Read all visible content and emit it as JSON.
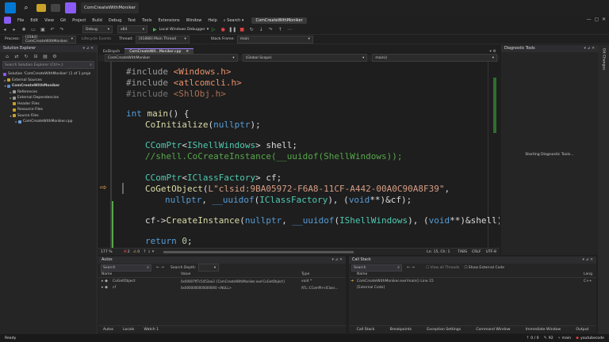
{
  "taskbar": {
    "search_icon": "search-icon",
    "app_label": "ComCreateWithMoniker"
  },
  "menu": {
    "items": [
      "File",
      "Edit",
      "View",
      "Git",
      "Project",
      "Build",
      "Debug",
      "Test",
      "Tools",
      "Extensions",
      "Window",
      "Help"
    ],
    "search": "Search",
    "solution_title": "ComCreateWithMoniker"
  },
  "toolbar": {
    "config": "Debug",
    "platform": "x64",
    "run_label": "Local Windows Debugger"
  },
  "debugbar": {
    "process_label": "Process:",
    "process_value": "[3584] ComCreateWithMoniker.",
    "lifecycle": "Lifecycle Events",
    "thread_label": "Thread:",
    "thread_value": "[41888] Main Thread",
    "stack_label": "Stack Frame:",
    "stack_value": "main"
  },
  "solution_explorer": {
    "title": "Solution Explorer",
    "search_placeholder": "Search Solution Explorer (Ctrl+;)",
    "items": [
      {
        "label": "Solution 'ComCreateWithMoniker' (1 of 1 proje",
        "indent": 1,
        "bold": false
      },
      {
        "label": "External Sources",
        "indent": 1,
        "bold": false
      },
      {
        "label": "ComCreateWithMoniker",
        "indent": 1,
        "bold": true
      },
      {
        "label": "References",
        "indent": 2,
        "bold": false
      },
      {
        "label": "External Dependencies",
        "indent": 2,
        "bold": false
      },
      {
        "label": "Header Files",
        "indent": 2,
        "bold": false
      },
      {
        "label": "Resource Files",
        "indent": 2,
        "bold": false
      },
      {
        "label": "Source Files",
        "indent": 2,
        "bold": false
      },
      {
        "label": "ComCreateWithMoniker.cpp",
        "indent": 3,
        "bold": false
      }
    ]
  },
  "editor": {
    "tabs": [
      "ExDispch",
      "ComCreateWit...Moniker.cpp"
    ],
    "nav_project": "ComCreateWithMoniker",
    "nav_scope": "(Global Scope)",
    "nav_function": "main()",
    "zoom": "177 %",
    "errors": "2",
    "warnings": "0",
    "position": "Ln: 15, Ch: 1",
    "tabs_mode": "TABS",
    "line_ending": "CRLF",
    "encoding": "UTF-8"
  },
  "code": [
    "#include <Windows.h>",
    "#include <atlcomcli.h>",
    "#include <ShlObj.h>",
    "int main() {",
    "CoInitialize(nullptr);",
    "CComPtr<IShellWindows> shell;",
    "//shell.CoCreateInstance(__uuidof(ShellWindows));",
    "CComPtr<IClassFactory> cf;",
    "CoGetObject(L\"clsid:9BA05972-F6A8-11CF-A442-00A0C90A8F39\",",
    "nullptr, __uuidof(IClassFactory), (void**)&cf);",
    "cf->CreateInstance(nullptr, __uuidof(IShellWindows), (void**)&shell);",
    "return 0;"
  ],
  "diagnostic": {
    "title": "Diagnostic Tools",
    "status": "Starting Diagnostic Tools..."
  },
  "right_strip": "Git Changes",
  "autos": {
    "title": "Autos",
    "search_placeholder": "Search",
    "depth_label": "Search Depth:",
    "columns": [
      "Name",
      "Value",
      "Type"
    ],
    "rows": [
      {
        "name": "CoGetObject",
        "value": "0x00007ff7c5453aa3 {ComCreateWithMoniker.exe!CoGetObject}",
        "type": "void *"
      },
      {
        "name": "cf",
        "value": "0x0000000000000000 <NULL>",
        "type": "ATL::CComPtr<IClass..."
      }
    ],
    "tabs": [
      "Autos",
      "Locals",
      "Watch 1"
    ]
  },
  "callstack": {
    "title": "Call Stack",
    "search_placeholder": "Search",
    "view_threads": "View all Threads",
    "show_external": "Show External Code",
    "columns": [
      "Name",
      "Lang"
    ],
    "rows": [
      {
        "name": "ComCreateWithMoniker.exe!main() Line 15",
        "lang": "C++"
      },
      {
        "name": "[External Code]",
        "lang": ""
      }
    ],
    "tabs": [
      "Call Stack",
      "Breakpoints",
      "Exception Settings",
      "Command Window",
      "Immediate Window",
      "Output"
    ]
  },
  "statusbar": {
    "ready": "Ready",
    "up": "0 / 0",
    "pencil": "92",
    "branch": "main",
    "user": "youtubecode"
  },
  "colors": {
    "accent": "#9b7bff",
    "keyword": "#569cd6",
    "function": "#dcdcaa",
    "type": "#4ec9b0",
    "comment": "#57a64a"
  }
}
